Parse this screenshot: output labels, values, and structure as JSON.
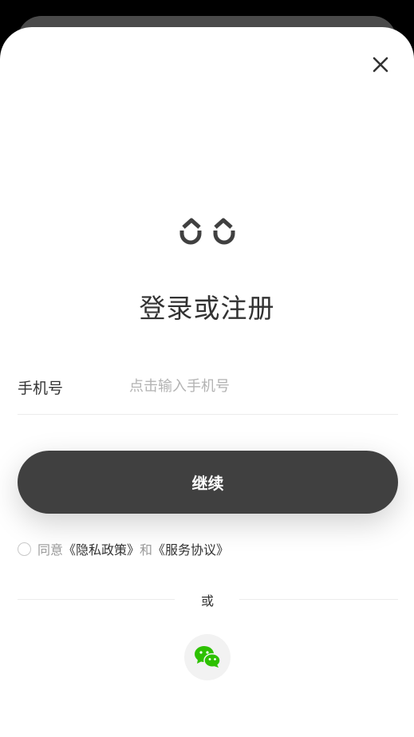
{
  "title": "登录或注册",
  "phone": {
    "label": "手机号",
    "placeholder": "点击输入手机号",
    "value": ""
  },
  "continue_label": "继续",
  "agreement": {
    "prefix": "同意",
    "privacy_link": "《隐私政策》",
    "conjunction": "和",
    "service_link": "《服务协议》",
    "checked": false
  },
  "divider_text": "或",
  "social_login": [
    "wechat-icon"
  ],
  "icons": {
    "close": "close-icon",
    "logo": "logo-icon",
    "wechat": "wechat-icon"
  },
  "colors": {
    "primary_button": "#404040",
    "wechat_green": "#2dc100",
    "text": "#333333",
    "placeholder": "#b3b3b3"
  }
}
